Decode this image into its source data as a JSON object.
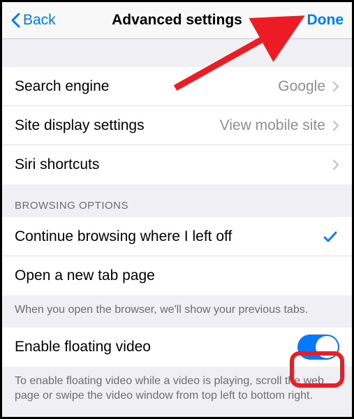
{
  "navbar": {
    "back": "Back",
    "title": "Advanced settings",
    "done": "Done"
  },
  "group1": {
    "search_engine": {
      "label": "Search engine",
      "value": "Google"
    },
    "site_display": {
      "label": "Site display settings",
      "value": "View mobile site"
    },
    "siri": {
      "label": "Siri shortcuts"
    }
  },
  "browsing": {
    "header": "BROWSING OPTIONS",
    "continue": {
      "label": "Continue browsing where I left off"
    },
    "newtab": {
      "label": "Open a new tab page"
    },
    "footer": "When you open the browser, we'll show your previous tabs."
  },
  "floating": {
    "label": "Enable floating video",
    "footer": "To enable floating video while a video is playing, scroll the web page or swipe the video window from top left to bottom right."
  }
}
